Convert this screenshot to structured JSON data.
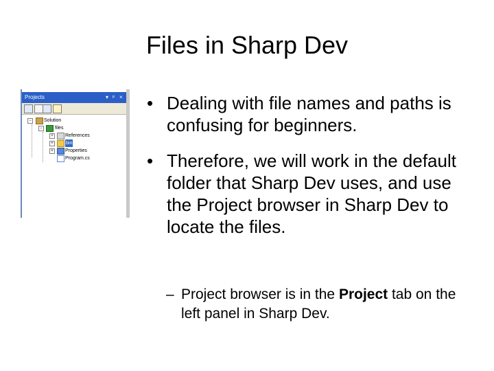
{
  "slide": {
    "title": "Files in Sharp Dev"
  },
  "screenshot": {
    "panel_title": "Projects",
    "panel_controls": [
      "▾",
      "ᵖ",
      "×"
    ],
    "tree": [
      {
        "label": "Solution "
      },
      {
        "label": "files"
      },
      {
        "label": "References"
      },
      {
        "label": "bin"
      },
      {
        "label": "Properties"
      },
      {
        "label": "Program.cs"
      }
    ]
  },
  "bullets": [
    {
      "text": "Dealing with file names and paths is confusing for beginners."
    },
    {
      "text": "Therefore, we will work in the default folder that Sharp Dev uses, and use the Project browser in Sharp Dev to locate the files."
    }
  ],
  "sub_bullet": {
    "dash": "–",
    "text_before": "Project browser is in the ",
    "text_bold": "Project",
    "text_after": " tab on the left panel in Sharp Dev."
  },
  "bullet_glyph": "•"
}
